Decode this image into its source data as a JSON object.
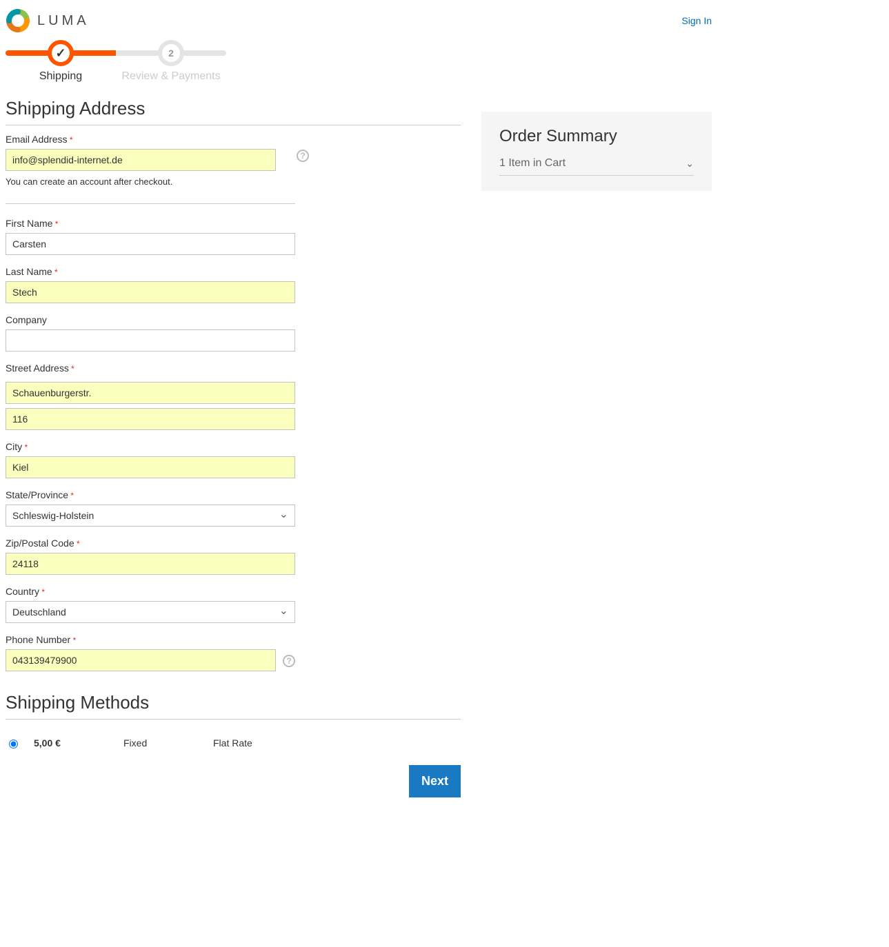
{
  "header": {
    "brand": "LUMA",
    "sign_in": "Sign In"
  },
  "progress": {
    "step1_label": "Shipping",
    "step2_label": "Review & Payments",
    "step2_num": "2"
  },
  "shipping_address": {
    "title": "Shipping Address",
    "email_label": "Email Address",
    "email_value": "info@splendid-internet.de",
    "email_note": "You can create an account after checkout.",
    "first_name_label": "First Name",
    "first_name_value": "Carsten",
    "last_name_label": "Last Name",
    "last_name_value": "Stech",
    "company_label": "Company",
    "company_value": "",
    "street_label": "Street Address",
    "street1_value": "Schauenburgerstr.",
    "street2_value": "116",
    "city_label": "City",
    "city_value": "Kiel",
    "state_label": "State/Province",
    "state_value": "Schleswig-Holstein",
    "zip_label": "Zip/Postal Code",
    "zip_value": "24118",
    "country_label": "Country",
    "country_value": "Deutschland",
    "phone_label": "Phone Number",
    "phone_value": "043139479900"
  },
  "shipping_methods": {
    "title": "Shipping Methods",
    "price": "5,00 €",
    "type": "Fixed",
    "carrier": "Flat Rate"
  },
  "next_button": "Next",
  "sidebar": {
    "title": "Order Summary",
    "cart_line": "1 Item in Cart"
  }
}
